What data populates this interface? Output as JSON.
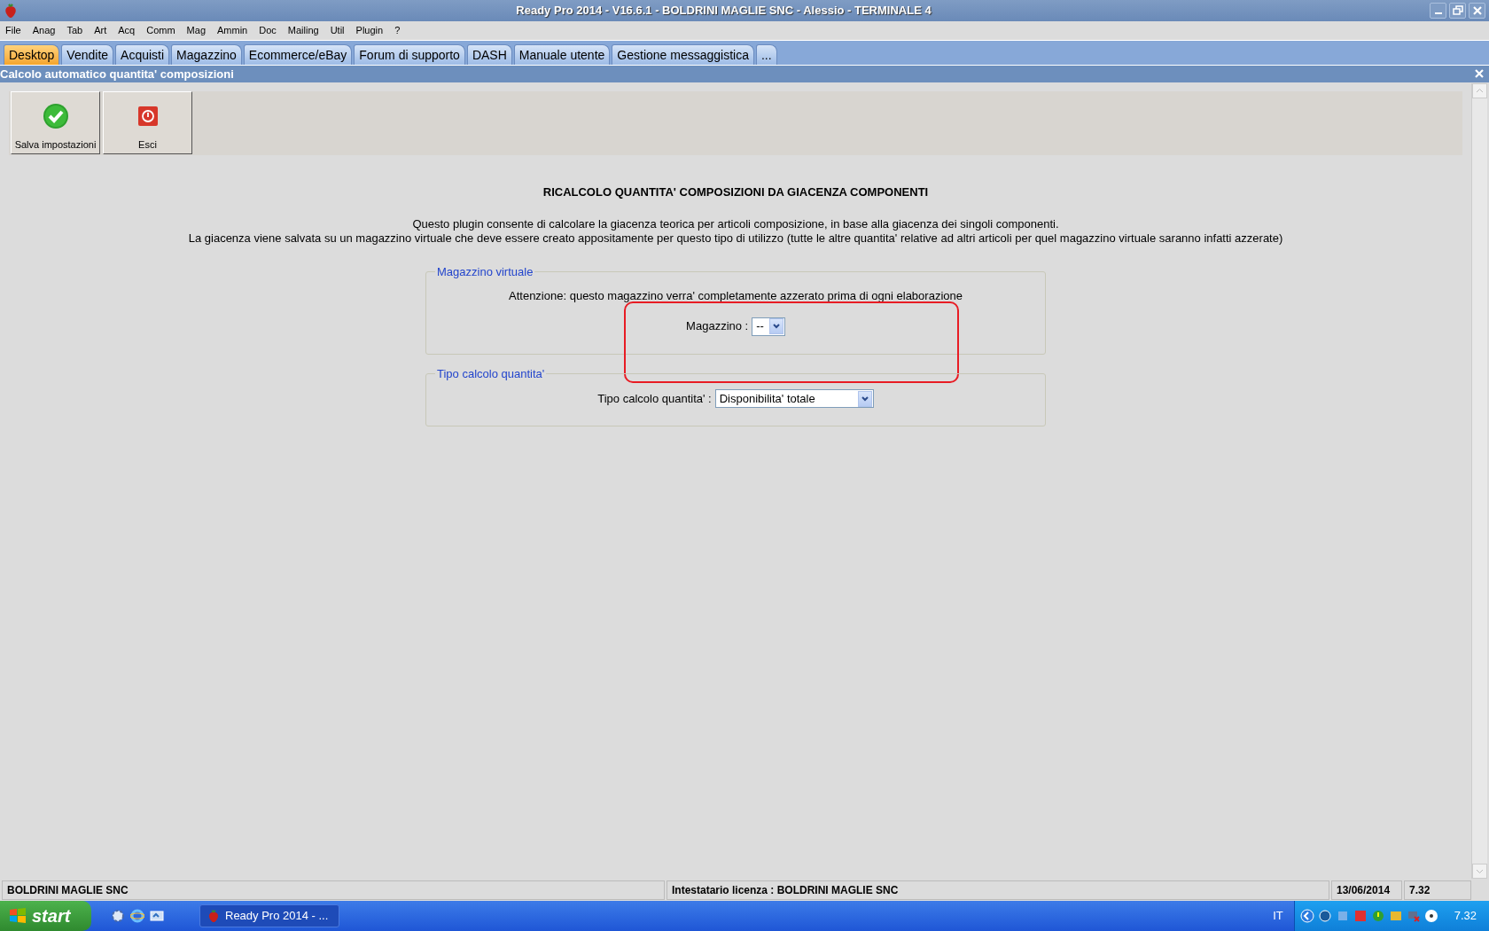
{
  "window": {
    "title": "Ready Pro 2014 - V16.6.1 - BOLDRINI MAGLIE SNC - Alessio - TERMINALE 4"
  },
  "menu": [
    "File",
    "Anag",
    "Tab",
    "Art",
    "Acq",
    "Comm",
    "Mag",
    "Ammin",
    "Doc",
    "Mailing",
    "Util",
    "Plugin",
    "?"
  ],
  "tabs": [
    {
      "label": "Desktop",
      "selected": true
    },
    {
      "label": "Vendite",
      "selected": false
    },
    {
      "label": "Acquisti",
      "selected": false
    },
    {
      "label": "Magazzino",
      "selected": false
    },
    {
      "label": "Ecommerce/eBay",
      "selected": false
    },
    {
      "label": "Forum di supporto",
      "selected": false
    },
    {
      "label": "DASH",
      "selected": false
    },
    {
      "label": "Manuale utente",
      "selected": false
    },
    {
      "label": "Gestione messaggistica",
      "selected": false
    },
    {
      "label": "...",
      "selected": false
    }
  ],
  "subwindow": {
    "title": "Calcolo automatico quantita' composizioni"
  },
  "toolbar": [
    {
      "label": "Salva impostazioni",
      "kind": "save"
    },
    {
      "label": "Esci",
      "kind": "exit"
    }
  ],
  "heading": "RICALCOLO QUANTITA' COMPOSIZIONI DA GIACENZA COMPONENTI",
  "description": [
    "Questo plugin consente di calcolare la giacenza teorica per articoli composizione, in base alla giacenza dei singoli componenti.",
    "La giacenza viene salvata su un magazzino virtuale che deve essere creato appositamente per questo tipo di utilizzo (tutte le altre quantita' relative ad altri articoli per quel magazzino virtuale saranno infatti azzerate)"
  ],
  "groups": [
    {
      "legend": "Magazzino virtuale",
      "note": "Attenzione: questo magazzino verra' completamente azzerato prima di ogni elaborazione",
      "field_label": "Magazzino :",
      "value": "--",
      "highlighted": true
    },
    {
      "legend": "Tipo calcolo quantita'",
      "field_label": "Tipo calcolo quantita' :",
      "value": "Disponibilita' totale",
      "highlighted": false
    }
  ],
  "status_bar": [
    "BOLDRINI MAGLIE SNC",
    "Intestatario licenza : BOLDRINI MAGLIE SNC",
    "13/06/2014",
    "7.32"
  ],
  "taskbar": {
    "start": "start",
    "task": "Ready Pro 2014 - ...",
    "language": "IT",
    "clock": "7.32"
  }
}
